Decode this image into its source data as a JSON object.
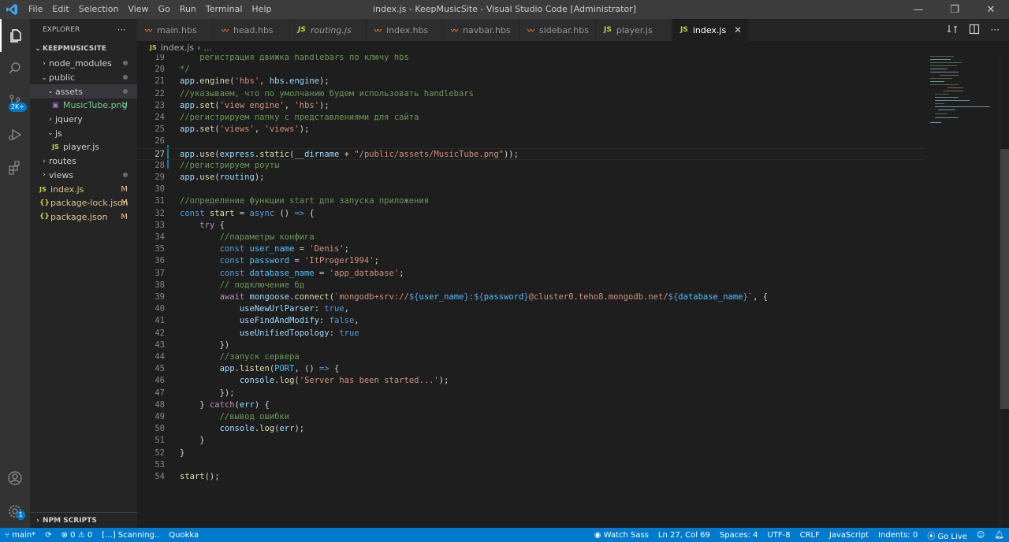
{
  "window": {
    "title": "index.js - KeepMusicSite - Visual Studio Code [Administrator]",
    "menu": [
      "File",
      "Edit",
      "Selection",
      "View",
      "Go",
      "Run",
      "Terminal",
      "Help"
    ]
  },
  "activity": {
    "badge": "2K+",
    "settings_badge": "1"
  },
  "explorer": {
    "header": "EXPLORER",
    "more": "···",
    "project": "KEEPMUSICSITE",
    "items": [
      {
        "label": "node_modules",
        "indent": 1,
        "chev": "›",
        "status": "dot"
      },
      {
        "label": "public",
        "indent": 1,
        "chev": "⌄",
        "status": "dot"
      },
      {
        "label": "assets",
        "indent": 2,
        "chev": "⌄",
        "status": "dot",
        "selected": true
      },
      {
        "label": "MusicTube.png",
        "indent": 3,
        "icon": "png",
        "status": "U"
      },
      {
        "label": "jquery",
        "indent": 2,
        "chev": "›"
      },
      {
        "label": "js",
        "indent": 2,
        "chev": "⌄"
      },
      {
        "label": "player.js",
        "indent": 3,
        "icon": "js"
      },
      {
        "label": "routes",
        "indent": 1,
        "chev": "›"
      },
      {
        "label": "views",
        "indent": 1,
        "chev": "›",
        "status": "dot"
      },
      {
        "label": "index.js",
        "indent": 1,
        "icon": "js",
        "status": "M"
      },
      {
        "label": "package-lock.json",
        "indent": 1,
        "icon": "json",
        "status": "M"
      },
      {
        "label": "package.json",
        "indent": 1,
        "icon": "json",
        "status": "M"
      }
    ],
    "npm_scripts": "NPM SCRIPTS"
  },
  "tabs": [
    {
      "label": "main.hbs",
      "type": "hbs"
    },
    {
      "label": "head.hbs",
      "type": "hbs"
    },
    {
      "label": "routing.js",
      "type": "js",
      "italic": true
    },
    {
      "label": "index.hbs",
      "type": "hbs"
    },
    {
      "label": "navbar.hbs",
      "type": "hbs"
    },
    {
      "label": "sidebar.hbs",
      "type": "hbs"
    },
    {
      "label": "player.js",
      "type": "js"
    },
    {
      "label": "index.js",
      "type": "js",
      "active": true
    }
  ],
  "breadcrumb": {
    "file": "index.js",
    "rest": "..."
  },
  "current_line": 27,
  "code": [
    {
      "n": "19",
      "t": [
        [
          "c",
          "    регистрация движка handlebars по ключу hbs"
        ]
      ]
    },
    {
      "n": "20",
      "t": [
        [
          "c",
          "*/"
        ]
      ]
    },
    {
      "n": "21",
      "t": [
        [
          "v",
          "app"
        ],
        [
          "p",
          "."
        ],
        [
          "f",
          "engine"
        ],
        [
          "p",
          "("
        ],
        [
          "s",
          "'hbs'"
        ],
        [
          "p",
          ", "
        ],
        [
          "v",
          "hbs"
        ],
        [
          "p",
          "."
        ],
        [
          "v",
          "engine"
        ],
        [
          "p",
          ");"
        ]
      ]
    },
    {
      "n": "22",
      "t": [
        [
          "c",
          "//указываем, что по умолчанию будем использовать handlebars"
        ]
      ]
    },
    {
      "n": "23",
      "t": [
        [
          "v",
          "app"
        ],
        [
          "p",
          "."
        ],
        [
          "f",
          "set"
        ],
        [
          "p",
          "("
        ],
        [
          "s",
          "'view engine'"
        ],
        [
          "p",
          ", "
        ],
        [
          "s",
          "'hbs'"
        ],
        [
          "p",
          ");"
        ]
      ]
    },
    {
      "n": "24",
      "t": [
        [
          "c",
          "//регистрируем папку с представлениями для сайта"
        ]
      ]
    },
    {
      "n": "25",
      "t": [
        [
          "v",
          "app"
        ],
        [
          "p",
          "."
        ],
        [
          "f",
          "set"
        ],
        [
          "p",
          "("
        ],
        [
          "s",
          "'views'"
        ],
        [
          "p",
          ", "
        ],
        [
          "s",
          "'views'"
        ],
        [
          "p",
          ");"
        ]
      ]
    },
    {
      "n": "26",
      "t": []
    },
    {
      "n": "27",
      "t": [
        [
          "v",
          "app"
        ],
        [
          "p",
          "."
        ],
        [
          "f",
          "use"
        ],
        [
          "p",
          "("
        ],
        [
          "v",
          "express"
        ],
        [
          "p",
          "."
        ],
        [
          "f",
          "static"
        ],
        [
          "p",
          "("
        ],
        [
          "v",
          "__dirname"
        ],
        [
          "p",
          " + "
        ],
        [
          "s",
          "\"/public/assets/MusicTube.png\""
        ],
        [
          "p",
          "));"
        ]
      ]
    },
    {
      "n": "28",
      "t": [
        [
          "c",
          "//регистрируем роуты"
        ]
      ]
    },
    {
      "n": "29",
      "t": [
        [
          "v",
          "app"
        ],
        [
          "p",
          "."
        ],
        [
          "f",
          "use"
        ],
        [
          "p",
          "("
        ],
        [
          "v",
          "routing"
        ],
        [
          "p",
          ");"
        ]
      ]
    },
    {
      "n": "30",
      "t": []
    },
    {
      "n": "31",
      "t": [
        [
          "c",
          "//определение функции start для запуска приложения"
        ]
      ]
    },
    {
      "n": "32",
      "t": [
        [
          "k",
          "const "
        ],
        [
          "f",
          "start"
        ],
        [
          "p",
          " = "
        ],
        [
          "k",
          "async "
        ],
        [
          "p",
          "() "
        ],
        [
          "k",
          "=>"
        ],
        [
          "p",
          " {"
        ]
      ]
    },
    {
      "n": "33",
      "t": [
        [
          "p",
          "    "
        ],
        [
          "kc",
          "try"
        ],
        [
          "p",
          " {"
        ]
      ]
    },
    {
      "n": "34",
      "t": [
        [
          "p",
          "        "
        ],
        [
          "c",
          "//параметры конфига"
        ]
      ]
    },
    {
      "n": "35",
      "t": [
        [
          "p",
          "        "
        ],
        [
          "k",
          "const "
        ],
        [
          "cn",
          "user_name"
        ],
        [
          "p",
          " = "
        ],
        [
          "s",
          "'Denis'"
        ],
        [
          "p",
          ";"
        ]
      ]
    },
    {
      "n": "36",
      "t": [
        [
          "p",
          "        "
        ],
        [
          "k",
          "const "
        ],
        [
          "cn",
          "password"
        ],
        [
          "p",
          " = "
        ],
        [
          "s",
          "'ItProger1994'"
        ],
        [
          "p",
          ";"
        ]
      ]
    },
    {
      "n": "37",
      "t": [
        [
          "p",
          "        "
        ],
        [
          "k",
          "const "
        ],
        [
          "cn",
          "database_name"
        ],
        [
          "p",
          " = "
        ],
        [
          "s",
          "'app_database'"
        ],
        [
          "p",
          ";"
        ]
      ]
    },
    {
      "n": "38",
      "t": [
        [
          "p",
          "        "
        ],
        [
          "c",
          "// подключение бд"
        ]
      ]
    },
    {
      "n": "39",
      "t": [
        [
          "p",
          "        "
        ],
        [
          "kc",
          "await "
        ],
        [
          "v",
          "mongoose"
        ],
        [
          "p",
          "."
        ],
        [
          "f",
          "connect"
        ],
        [
          "p",
          "("
        ],
        [
          "s",
          "`mongodb+srv://"
        ],
        [
          "k",
          "${"
        ],
        [
          "cn",
          "user_name"
        ],
        [
          "k",
          "}"
        ],
        [
          "s",
          ":"
        ],
        [
          "k",
          "${"
        ],
        [
          "cn",
          "password"
        ],
        [
          "k",
          "}"
        ],
        [
          "s",
          "@cluster0.teho8.mongodb.net/"
        ],
        [
          "k",
          "${"
        ],
        [
          "cn",
          "database_name"
        ],
        [
          "k",
          "}"
        ],
        [
          "s",
          "`"
        ],
        [
          "p",
          ", {"
        ]
      ]
    },
    {
      "n": "40",
      "t": [
        [
          "p",
          "            "
        ],
        [
          "v",
          "useNewUrlParser"
        ],
        [
          "p",
          ": "
        ],
        [
          "k",
          "true"
        ],
        [
          "p",
          ","
        ]
      ]
    },
    {
      "n": "41",
      "t": [
        [
          "p",
          "            "
        ],
        [
          "v",
          "useFindAndModify"
        ],
        [
          "p",
          ": "
        ],
        [
          "k",
          "false"
        ],
        [
          "p",
          ","
        ]
      ]
    },
    {
      "n": "42",
      "t": [
        [
          "p",
          "            "
        ],
        [
          "v",
          "useUnifiedTopology"
        ],
        [
          "p",
          ": "
        ],
        [
          "k",
          "true"
        ]
      ]
    },
    {
      "n": "43",
      "t": [
        [
          "p",
          "        })"
        ]
      ]
    },
    {
      "n": "44",
      "t": [
        [
          "p",
          "        "
        ],
        [
          "c",
          "//запуск сервера"
        ]
      ]
    },
    {
      "n": "45",
      "t": [
        [
          "p",
          "        "
        ],
        [
          "v",
          "app"
        ],
        [
          "p",
          "."
        ],
        [
          "f",
          "listen"
        ],
        [
          "p",
          "("
        ],
        [
          "cn",
          "PORT"
        ],
        [
          "p",
          ", () "
        ],
        [
          "k",
          "=>"
        ],
        [
          "p",
          " {"
        ]
      ]
    },
    {
      "n": "46",
      "t": [
        [
          "p",
          "            "
        ],
        [
          "v",
          "console"
        ],
        [
          "p",
          "."
        ],
        [
          "f",
          "log"
        ],
        [
          "p",
          "("
        ],
        [
          "s",
          "'Server has been started...'"
        ],
        [
          "p",
          ");"
        ]
      ]
    },
    {
      "n": "47",
      "t": [
        [
          "p",
          "        });"
        ]
      ]
    },
    {
      "n": "48",
      "t": [
        [
          "p",
          "    } "
        ],
        [
          "kc",
          "catch"
        ],
        [
          "p",
          "("
        ],
        [
          "v",
          "err"
        ],
        [
          "p",
          ") {"
        ]
      ]
    },
    {
      "n": "49",
      "t": [
        [
          "p",
          "        "
        ],
        [
          "c",
          "//вывод ошибки"
        ]
      ]
    },
    {
      "n": "50",
      "t": [
        [
          "p",
          "        "
        ],
        [
          "v",
          "console"
        ],
        [
          "p",
          "."
        ],
        [
          "f",
          "log"
        ],
        [
          "p",
          "("
        ],
        [
          "v",
          "err"
        ],
        [
          "p",
          ");"
        ]
      ]
    },
    {
      "n": "51",
      "t": [
        [
          "p",
          "    }"
        ]
      ]
    },
    {
      "n": "52",
      "t": [
        [
          "p",
          "}"
        ]
      ]
    },
    {
      "n": "53",
      "t": []
    },
    {
      "n": "54",
      "t": [
        [
          "f",
          "start"
        ],
        [
          "p",
          "();"
        ]
      ]
    }
  ],
  "status": {
    "branch": "main*",
    "sync": "⟳",
    "errors": "0",
    "warnings": "0",
    "scanning": "[...] Scanning..",
    "quokka": "Quokka",
    "watch_sass": "Watch Sass",
    "position": "Ln 27, Col 69",
    "spaces": "Spaces: 4",
    "encoding": "UTF-8",
    "eol": "CRLF",
    "language": "JavaScript",
    "indents": "Indents: 0",
    "go_live": "Go Live"
  }
}
